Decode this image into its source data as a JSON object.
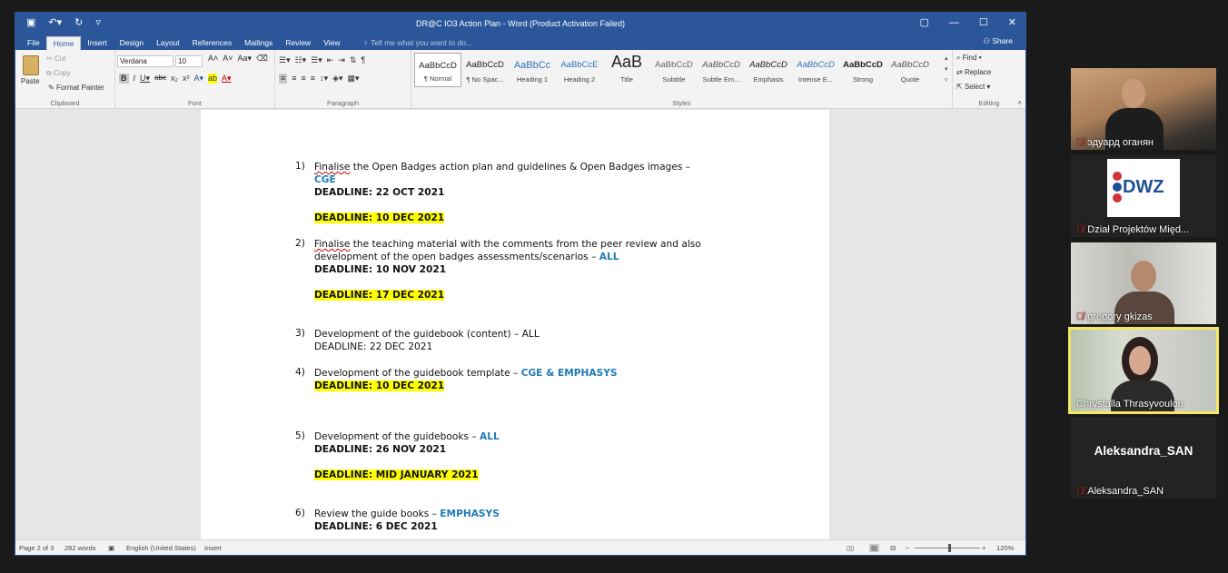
{
  "word": {
    "title": "DR@C IO3 Action Plan - Word (Product Activation Failed)",
    "tabs": [
      "File",
      "Home",
      "Insert",
      "Design",
      "Layout",
      "References",
      "Mailings",
      "Review",
      "View"
    ],
    "active_tab": "Home",
    "tell_me": "Tell me what you want to do...",
    "share": "Share",
    "clipboard": {
      "paste": "Paste",
      "cut": "Cut",
      "copy": "Copy",
      "format_painter": "Format Painter",
      "label": "Clipboard"
    },
    "font": {
      "name": "Verdana",
      "size": "10",
      "label": "Font"
    },
    "paragraph": {
      "label": "Paragraph"
    },
    "styles": {
      "label": "Styles",
      "items": [
        {
          "preview": "AaBbCcD",
          "name": "¶ Normal"
        },
        {
          "preview": "AaBbCcD",
          "name": "¶ No Spac..."
        },
        {
          "preview": "AaBbCc",
          "name": "Heading 1"
        },
        {
          "preview": "AaBbCcE",
          "name": "Heading 2"
        },
        {
          "preview": "AaB",
          "name": "Title"
        },
        {
          "preview": "AaBbCcD",
          "name": "Subtitle"
        },
        {
          "preview": "AaBbCcD",
          "name": "Subtle Em..."
        },
        {
          "preview": "AaBbCcD",
          "name": "Emphasis"
        },
        {
          "preview": "AaBbCcD",
          "name": "Intense E..."
        },
        {
          "preview": "AaBbCcD",
          "name": "Strong"
        },
        {
          "preview": "AaBbCcD",
          "name": "Quote"
        }
      ]
    },
    "editing": {
      "find": "Find",
      "replace": "Replace",
      "select": "Select",
      "label": "Editing"
    },
    "status": {
      "page": "Page 2 of 3",
      "words": "282 words",
      "language": "English (United States)",
      "mode": "Insert",
      "zoom": "120%"
    }
  },
  "doc": {
    "i1": {
      "num": "1)",
      "a": "Finalise",
      "b": " the Open Badges action plan and guidelines & Open Badges images –",
      "who": "CGE",
      "d1": "DEADLINE: 22 OCT 2021",
      "d2": "DEADLINE: 10 DEC 2021"
    },
    "i2": {
      "num": "2)",
      "a": "Finalise",
      "b": " the teaching material with the comments from the peer review and also",
      "c": "development of the open badges assessments/scenarios – ",
      "who": "ALL",
      "d1": "DEADLINE: 10 NOV 2021",
      "d2": "DEADLINE: 17 DEC 2021"
    },
    "i3": {
      "num": "3)",
      "line": "Development of the guidebook (content) – ALL",
      "d1": "DEADLINE: 22 DEC 2021"
    },
    "i4": {
      "num": "4)",
      "line": "Development of the guidebook  template – ",
      "who": "CGE & EMPHASYS",
      "d1": "DEADLINE: 10 DEC 2021"
    },
    "i5": {
      "num": "5)",
      "line": " Development of the guidebooks – ",
      "who": "ALL",
      "d1": "DEADLINE: 26 NOV 2021",
      "d2": "DEADLINE: MID JANUARY 2021"
    },
    "i6": {
      "num": "6)",
      "line": " Review the guide books – ",
      "who": "EMPHASYS",
      "d1": "DEADLINE: 6 DEC 2021"
    }
  },
  "participants": [
    {
      "name": "эдуард оганян",
      "muted": true
    },
    {
      "name": "Dział Projektów Międ...",
      "muted": true,
      "logo_text": "DWZ"
    },
    {
      "name": "gregory gkizas",
      "muted": true
    },
    {
      "name": "Chrystalla Thrasyvoulou",
      "muted": false,
      "active": true
    },
    {
      "name": "Aleksandra_SAN",
      "muted": true,
      "display": "Aleksandra_SAN"
    }
  ]
}
